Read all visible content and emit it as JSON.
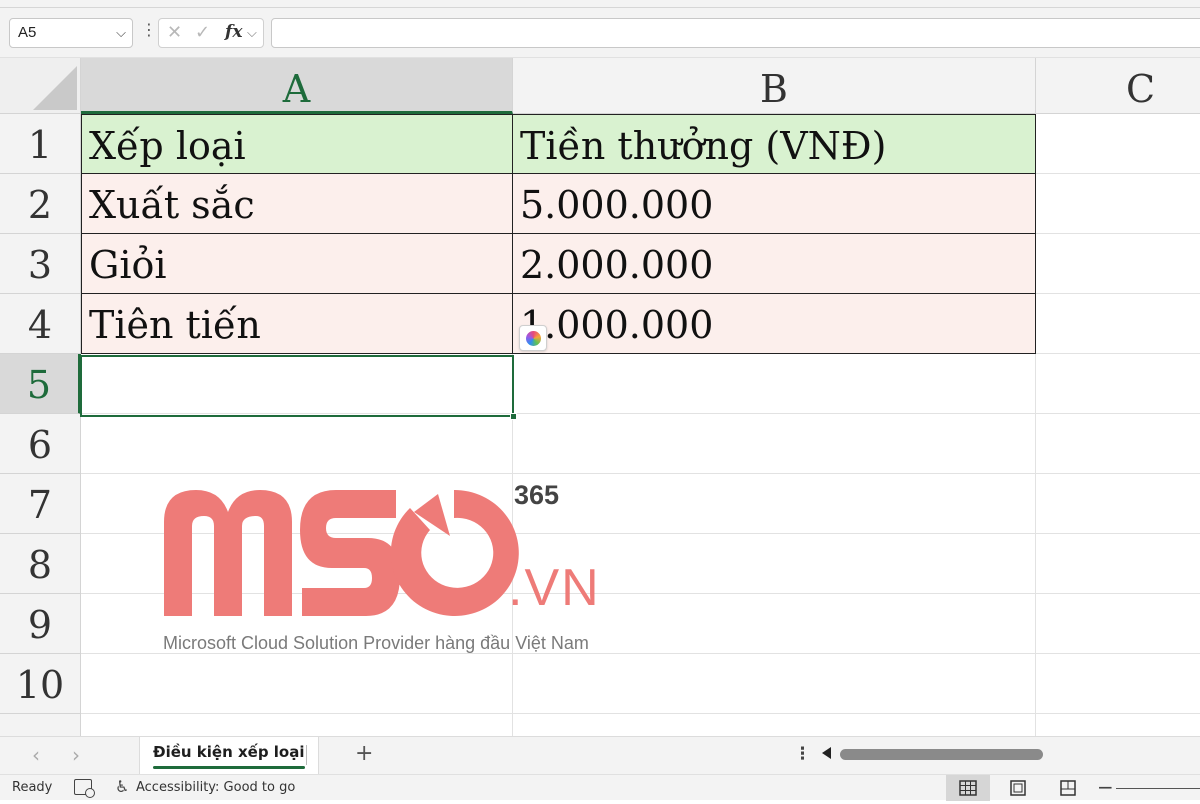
{
  "formula_bar": {
    "name_box": "A5",
    "cancel_icon": "✕",
    "enter_icon": "✓",
    "fx_label": "fx",
    "formula_value": ""
  },
  "columns": [
    "A",
    "B",
    "C"
  ],
  "rows": [
    "1",
    "2",
    "3",
    "4",
    "5",
    "6",
    "7",
    "8",
    "9",
    "10"
  ],
  "selected_cell": "A5",
  "table": {
    "header": {
      "a": "Xếp loại",
      "b": "Tiền thưởng (VNĐ)"
    },
    "rows": [
      {
        "a": "Xuất sắc",
        "b": "5.000.000"
      },
      {
        "a": "Giỏi",
        "b": "2.000.000"
      },
      {
        "a": "Tiên tiến",
        "b": "1.000.000"
      }
    ]
  },
  "watermark": {
    "brand": "MSO",
    "superscript": "365",
    "suffix": ".VN",
    "tagline": "Microsoft Cloud Solution Provider hàng đầu Việt Nam",
    "color": "#ee7b78"
  },
  "sheet_bar": {
    "active_sheet": "Điều kiện xếp loại",
    "add_icon": "+",
    "prev_icon": "‹",
    "next_icon": "›",
    "more_icon": "⋮"
  },
  "status_bar": {
    "ready": "Ready",
    "accessibility": "Accessibility: Good to go",
    "zoom_minus": "−"
  },
  "colors": {
    "accent": "#1e6b3b",
    "header_fill": "#d9f2d0",
    "body_fill": "#fcefec"
  }
}
